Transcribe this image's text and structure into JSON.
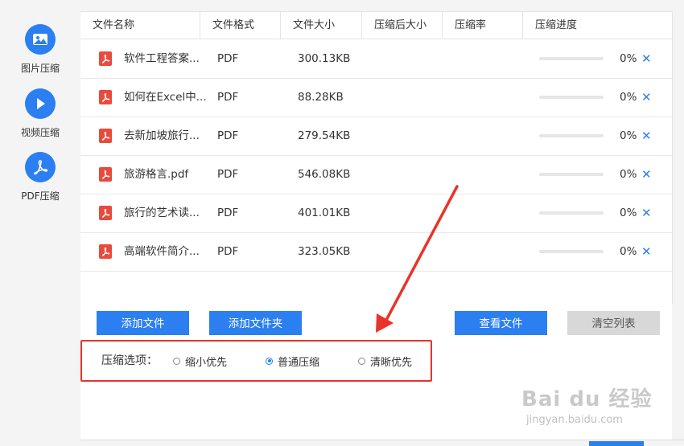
{
  "sidebar": {
    "items": [
      {
        "label": "图片压缩",
        "icon": "image-icon"
      },
      {
        "label": "视频压缩",
        "icon": "play-icon"
      },
      {
        "label": "PDF压缩",
        "icon": "pdf-icon"
      }
    ]
  },
  "table": {
    "headers": [
      "文件名称",
      "文件格式",
      "文件大小",
      "压缩后大小",
      "压缩率",
      "压缩进度"
    ],
    "rows": [
      {
        "name": "软件工程答案...",
        "format": "PDF",
        "size": "300.13KB",
        "compressed": "",
        "rate": "",
        "progress": 0,
        "progress_text": "0%"
      },
      {
        "name": "如何在Excel中...",
        "format": "PDF",
        "size": "88.28KB",
        "compressed": "",
        "rate": "",
        "progress": 0,
        "progress_text": "0%"
      },
      {
        "name": "去新加坡旅行...",
        "format": "PDF",
        "size": "279.54KB",
        "compressed": "",
        "rate": "",
        "progress": 0,
        "progress_text": "0%"
      },
      {
        "name": "旅游格言.pdf",
        "format": "PDF",
        "size": "546.08KB",
        "compressed": "",
        "rate": "",
        "progress": 0,
        "progress_text": "0%"
      },
      {
        "name": "旅行的艺术读...",
        "format": "PDF",
        "size": "401.01KB",
        "compressed": "",
        "rate": "",
        "progress": 0,
        "progress_text": "0%"
      },
      {
        "name": "高端软件简介...",
        "format": "PDF",
        "size": "323.05KB",
        "compressed": "",
        "rate": "",
        "progress": 0,
        "progress_text": "0%"
      }
    ],
    "remove_glyph": "✕"
  },
  "actions": {
    "add_file": "添加文件",
    "add_folder": "添加文件夹",
    "view_files": "查看文件",
    "clear_list": "清空列表"
  },
  "options": {
    "label": "压缩选项：",
    "choices": [
      "缩小优先",
      "普通压缩",
      "清晰优先"
    ],
    "selected": "普通压缩"
  },
  "watermark": {
    "logo": "Bai du 经验",
    "url": "jingyan.baidu.com"
  },
  "colors": {
    "accent": "#2b7ff0",
    "pdf_red": "#e84b3c",
    "highlight_red": "#e8342b"
  }
}
